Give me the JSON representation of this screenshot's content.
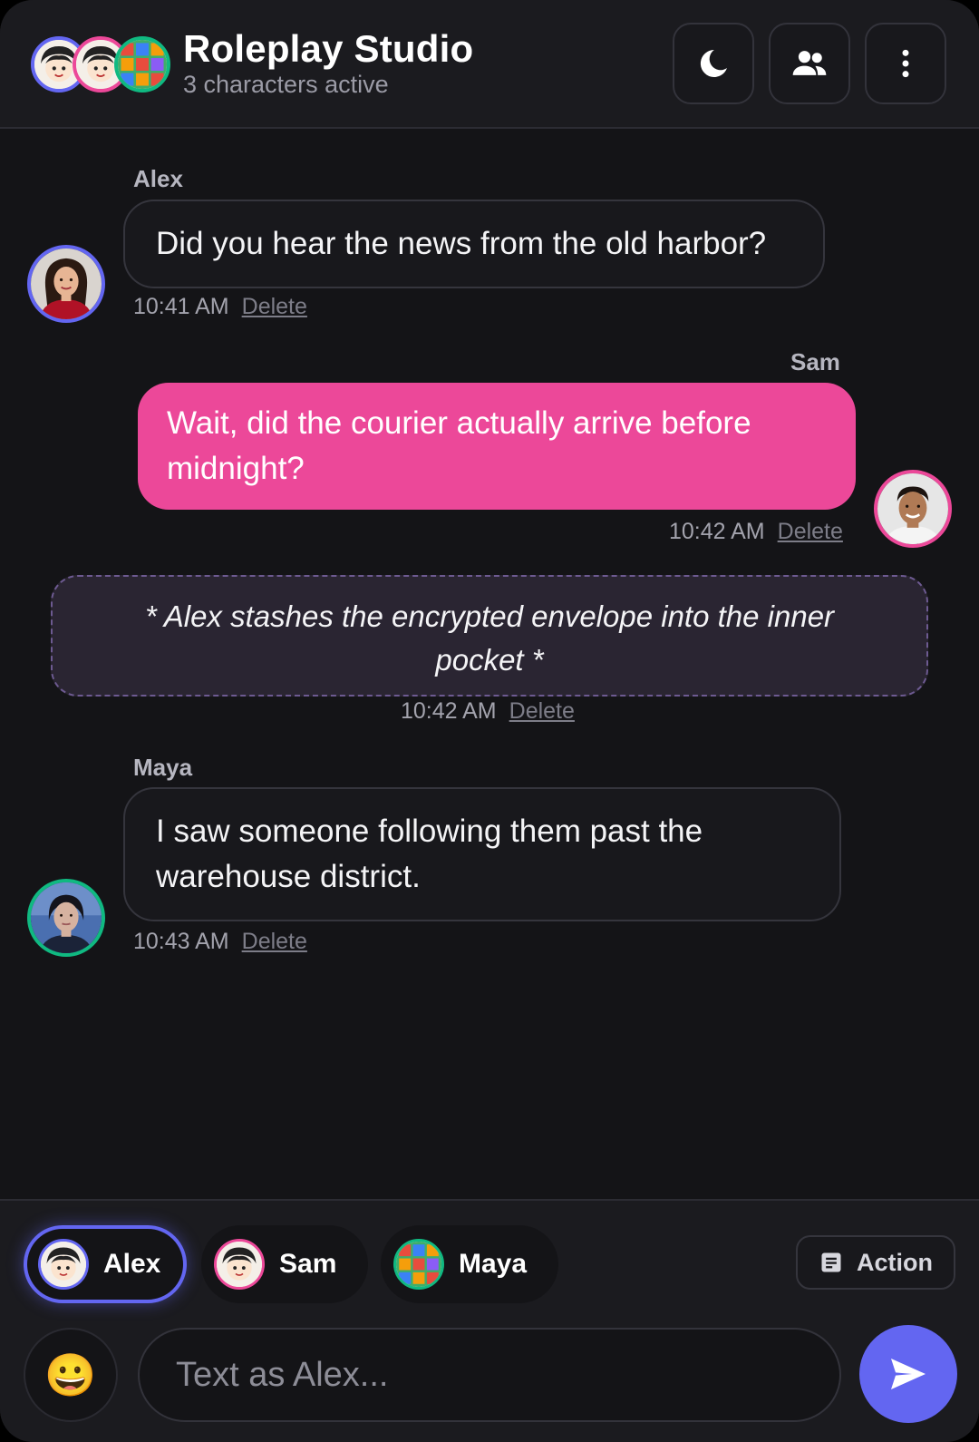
{
  "header": {
    "title": "Roleplay Studio",
    "subtitle": "3 characters active",
    "icons": [
      "moon-icon",
      "users-icon",
      "more-vertical-icon"
    ]
  },
  "colors": {
    "accent": "#6366f1",
    "sam": "#ec4899",
    "maya": "#10b981",
    "background": "#141417"
  },
  "messages": [
    {
      "type": "text",
      "author": "Alex",
      "text": "Did you hear the news from the old harbor?",
      "time": "10:41 AM",
      "delete_label": "Delete"
    },
    {
      "type": "text",
      "author": "Sam",
      "text": "Wait, did the courier actually arrive before midnight?",
      "time": "10:42 AM",
      "delete_label": "Delete"
    },
    {
      "type": "action",
      "text": "* Alex stashes the encrypted envelope into the inner pocket *",
      "time": "10:42 AM",
      "delete_label": "Delete"
    },
    {
      "type": "text",
      "author": "Maya",
      "text": "I saw someone following them past the warehouse district.",
      "time": "10:43 AM",
      "delete_label": "Delete"
    }
  ],
  "composer": {
    "characters": [
      {
        "label": "Alex",
        "active": true
      },
      {
        "label": "Sam",
        "active": false
      },
      {
        "label": "Maya",
        "active": false
      }
    ],
    "action_label": "Action",
    "emoji": "😀",
    "placeholder": "Text as Alex..."
  }
}
